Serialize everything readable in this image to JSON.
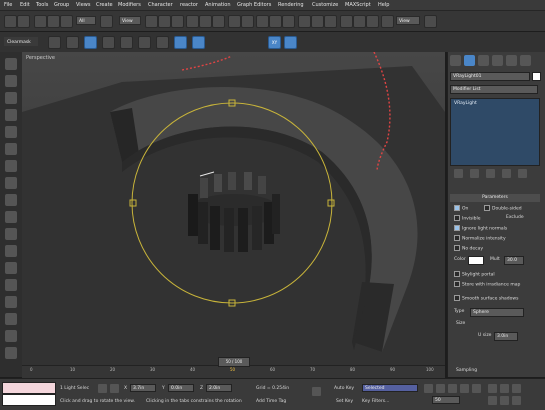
{
  "menu": [
    "File",
    "Edit",
    "Tools",
    "Group",
    "Views",
    "Create",
    "Modifiers",
    "Character",
    "reactor",
    "Animation",
    "Graph Editors",
    "Rendering",
    "Customize",
    "MAXScript",
    "Help"
  ],
  "toolbar": {
    "selection_filter": "All",
    "ref_coord": "View",
    "named_selection": "View",
    "clear_mask": "Clearmask",
    "axes": [
      "X",
      "Y",
      "Z"
    ],
    "axis_xy": "XY"
  },
  "viewport": {
    "label": "Perspective"
  },
  "right_panel": {
    "object_name": "VRayLight01",
    "modifier_list": "Modifier List",
    "stack_item": "VRayLight",
    "params_title": "Parameters",
    "on_label": "On",
    "double_sided": "Double-sided",
    "invisible": "Invisible",
    "exclude": "Exclude",
    "ignore_normals": "Ignore light normals",
    "no_decay": "No decay",
    "normalize": "Normalize intensity",
    "color_label": "Color",
    "mult_label": "Mult",
    "mult_value": "30.0",
    "skylight": "Skylight portal",
    "store_irradiance": "Store with irradiance map",
    "smooth_shadows": "Smooth surface shadows",
    "type_label": "Type",
    "type_value": "Sphere",
    "size_label": "Size",
    "u_size_label": "U size",
    "u_size_value": "3.0in",
    "sampling": "Sampling"
  },
  "timeline": {
    "frame": "50 / 100",
    "ticks": [
      "0",
      "10",
      "20",
      "30",
      "40",
      "50",
      "60",
      "70",
      "80",
      "90",
      "100"
    ]
  },
  "status": {
    "selected": "1 Light Selec",
    "x": "3.7in",
    "y": "0.0in",
    "z": "2.0in",
    "grid": "Grid = 0.254in",
    "autokey": "Auto Key",
    "setkey": "Set Key",
    "selected_dd": "Selected",
    "keyfilters": "Key Filters...",
    "prompt1": "Click and drag to rotate the view.",
    "prompt2": "Clicking in the tabs constrains the rotation",
    "add_time_tag": "Add Time Tag",
    "frame_field": "50"
  },
  "colors": {
    "accent": "#4a86c8",
    "light_ring": "#c8b43a",
    "viewport_bg": "#3d3d3d"
  }
}
